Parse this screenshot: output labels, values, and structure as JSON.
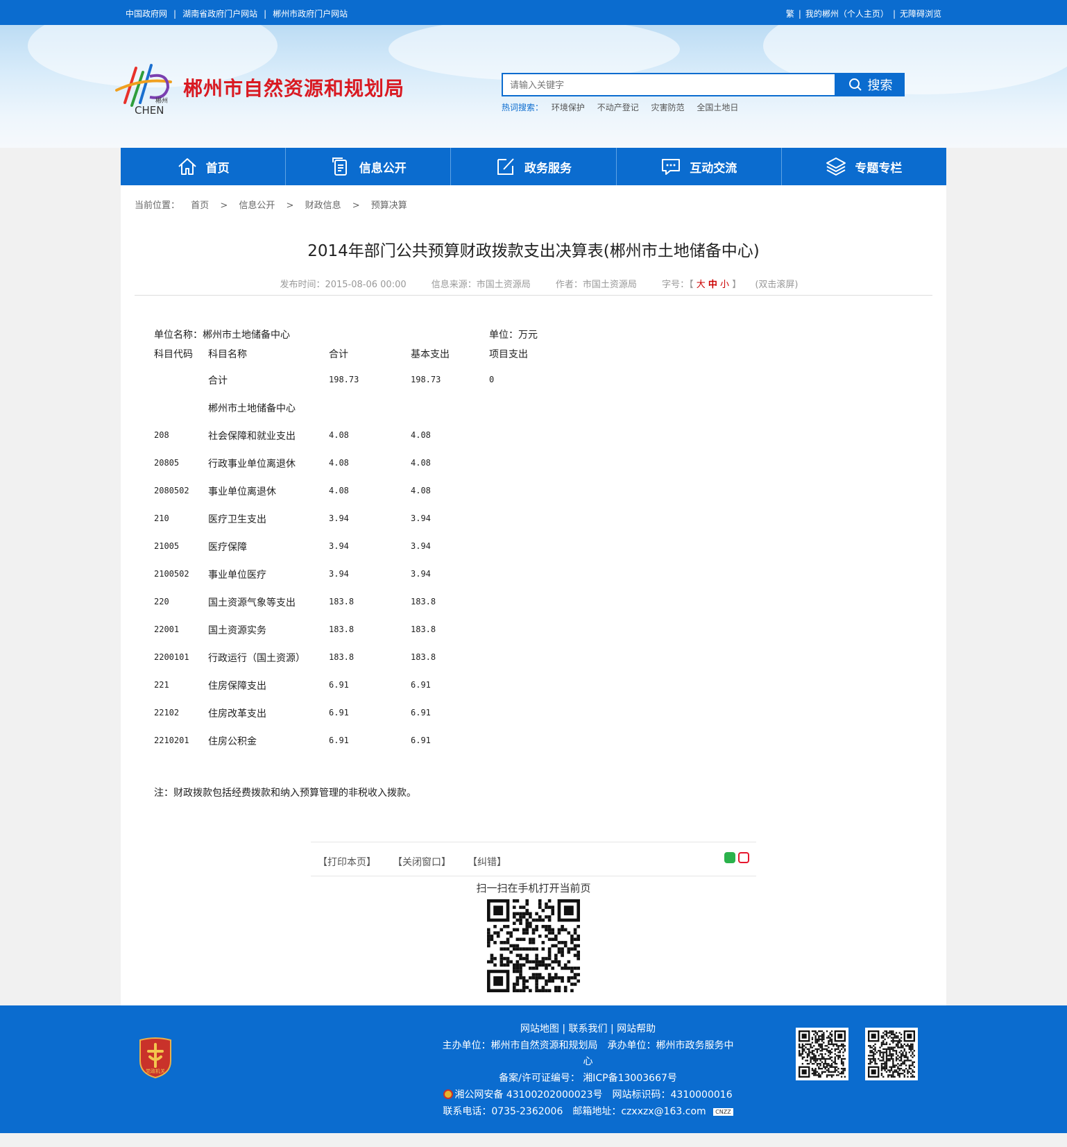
{
  "topbar": {
    "links": [
      "中国政府网",
      "湖南省政府门户网站",
      "郴州市政府门户网站"
    ],
    "right_links": [
      "繁",
      "我的郴州（个人主页）",
      "无障碍浏览"
    ]
  },
  "header": {
    "logo_text": "CHEN",
    "logo_text_small": "郴州",
    "site_title": "郴州市自然资源和规划局",
    "search_placeholder": "请输入关键字",
    "search_button": "搜索",
    "hot_label": "热词搜索：",
    "hot_words": [
      "环境保护",
      "不动产登记",
      "灾害防范",
      "全国土地日"
    ]
  },
  "nav": {
    "items": [
      {
        "label": "首页",
        "icon": "home-icon"
      },
      {
        "label": "信息公开",
        "icon": "document-icon"
      },
      {
        "label": "政务服务",
        "icon": "edit-icon"
      },
      {
        "label": "互动交流",
        "icon": "chat-icon"
      },
      {
        "label": "专题专栏",
        "icon": "layers-icon"
      }
    ]
  },
  "breadcrumb": {
    "label": "当前位置：",
    "items": [
      "首页",
      "信息公开",
      "财政信息",
      "预算决算"
    ],
    "separator": ">"
  },
  "article": {
    "title": "2014年部门公共预算财政拨款支出决算表(郴州市土地储备中心)",
    "publish_time": "发布时间：2015-08-06 00:00",
    "source": "信息来源：市国土资源局",
    "author": "作者：市国土资源局",
    "font_label": "字号：【",
    "font_large": "大",
    "font_medium": "中",
    "font_small": "小",
    "font_end": "】",
    "fullscreen": "(双击滚屏)"
  },
  "table": {
    "unit_name": "单位名称：郴州市土地储备中心",
    "unit": "单位：万元",
    "headers": [
      "科目代码",
      "科目名称",
      "合计",
      "基本支出",
      "项目支出"
    ],
    "rows": [
      {
        "code": "",
        "name": "合计",
        "total": "198.73",
        "basic": "198.73",
        "project": "0"
      },
      {
        "code": "",
        "name": "郴州市土地储备中心",
        "total": "",
        "basic": "",
        "project": ""
      },
      {
        "code": "208",
        "name": "社会保障和就业支出",
        "total": "4.08",
        "basic": "4.08",
        "project": ""
      },
      {
        "code": "20805",
        "name": "行政事业单位离退休",
        "total": "4.08",
        "basic": "4.08",
        "project": ""
      },
      {
        "code": "2080502",
        "name": "事业单位离退休",
        "total": "4.08",
        "basic": "4.08",
        "project": ""
      },
      {
        "code": "210",
        "name": "医疗卫生支出",
        "total": "3.94",
        "basic": "3.94",
        "project": ""
      },
      {
        "code": "21005",
        "name": "医疗保障",
        "total": "3.94",
        "basic": "3.94",
        "project": ""
      },
      {
        "code": "2100502",
        "name": "事业单位医疗",
        "total": "3.94",
        "basic": "3.94",
        "project": ""
      },
      {
        "code": "220",
        "name": "国土资源气象等支出",
        "total": "183.8",
        "basic": "183.8",
        "project": ""
      },
      {
        "code": "22001",
        "name": "国土资源实务",
        "total": "183.8",
        "basic": "183.8",
        "project": ""
      },
      {
        "code": "2200101",
        "name": "行政运行（国土资源）",
        "total": "183.8",
        "basic": "183.8",
        "project": ""
      },
      {
        "code": "221",
        "name": "住房保障支出",
        "total": "6.91",
        "basic": "6.91",
        "project": ""
      },
      {
        "code": "22102",
        "name": "住房改革支出",
        "total": "6.91",
        "basic": "6.91",
        "project": ""
      },
      {
        "code": "2210201",
        "name": "住房公积金",
        "total": "6.91",
        "basic": "6.91",
        "project": ""
      }
    ],
    "note": "注：财政拨款包括经费拨款和纳入预算管理的非税收入拨款。"
  },
  "tools": {
    "print": "【打印本页】",
    "close": "【关闭窗口】",
    "correct": "【纠错】",
    "qr_caption": "扫一扫在手机打开当前页"
  },
  "footer": {
    "links": "网站地图 | 联系我们 | 网站帮助",
    "host_line1": "主办单位：郴州市自然资源和规划局　承办单位：郴州市政务服务中",
    "host_line2": "心",
    "icp": "备案/许可证编号： 湘ICP备13003667号",
    "police": "湘公网安备 43100202000023号　网站标识码：4310000016",
    "contact": "联系电话：0735-2362006　邮箱地址：czxxzx@163.com",
    "cnzz": "CNZZ",
    "emblem_text": "党政机关"
  },
  "colors": {
    "primary_blue": "#0b6ccf",
    "title_red": "#d91a22",
    "background": "#f1f1f1"
  }
}
